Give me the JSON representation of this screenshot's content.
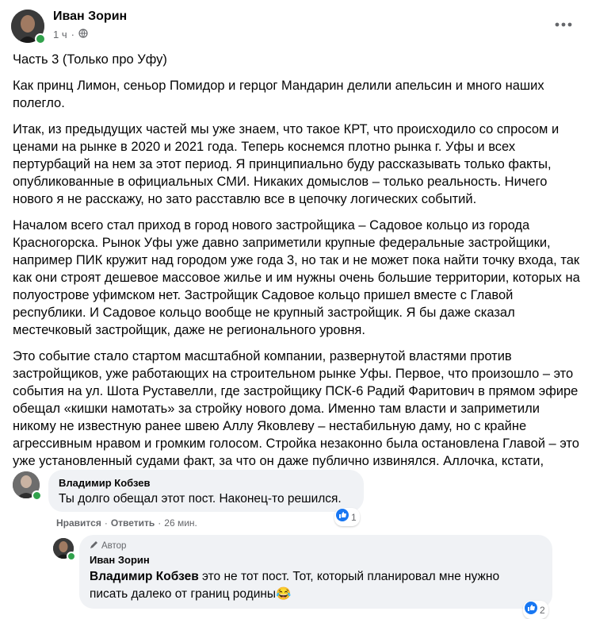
{
  "post": {
    "author": "Иван Зорин",
    "time": "1 ч",
    "separator": "·",
    "visibility_icon": "globe-icon",
    "paragraphs": [
      "Часть 3 (Только про Уфу)",
      "Как принц Лимон, сеньор Помидор и герцог Мандарин делили апельсин и много наших полегло.",
      "Итак, из предыдущих частей мы уже знаем, что такое КРТ, что происходило со спросом и ценами на рынке в 2020 и 2021 года. Теперь коснемся плотно рынка г. Уфы и всех пертурбаций на нем за этот период. Я принципиально буду рассказывать только факты, опубликованные в официальных СМИ. Никаких домыслов – только реальность. Ничего нового я не расскажу, но зато расставлю все в цепочку логических событий.",
      "Началом всего стал приход в город нового застройщика – Садовое кольцо из города Красногорска. Рынок Уфы уже давно заприметили крупные федеральные застройщики, например ПИК кружит над городом уже года 3, но так и не может пока найти точку входа, так как они строят дешевое массовое жилье и им нужны очень большие территории, которых на полуострове уфимском нет. Застройщик Садовое кольцо пришел вместе с Главой республики. И Садовое кольцо вообще не крупный застройщик. Я бы даже сказал местечковый застройщик, даже не регионального уровня.",
      "Это событие стало стартом масштабной компании, развернутой властями против застройщиков, уже работающих на строительном рынке Уфы. Первое, что произошло – это события на ул. Шота Руставелли, где застройщику ПСК-6 Радий Фаритович в прямом эфире обещал «кишки намотать» за стройку нового дома. Именно там власти и заприметили никому не известную ранее швею Аллу Яковлеву – нестабильную даму, но с крайне агрессивным нравом и громким голосом. Стройка незаконно была остановлена Главой – это уже установленный судами факт, за что он даже публично извинялся. Аллочка, кстати,"
    ]
  },
  "comment": {
    "author": "Владимир Кобзев",
    "text": "Ты долго обещал этот пост. Наконец-то решился.",
    "like_label": "Нравится",
    "reply_label": "Ответить",
    "time": "26 мин.",
    "reaction_count": "1"
  },
  "reply": {
    "badge": "Автор",
    "author": "Иван Зорин",
    "mention": "Владимир Кобзев",
    "text_line1": " это не тот пост. Тот, который планировал мне нужно",
    "text_line2": "писать далеко от границ родины",
    "emoji": "😂",
    "reaction_count": "2"
  },
  "colors": {
    "online": "#31a24c",
    "like_blue": "#1877f2",
    "bubble": "#f0f2f5"
  }
}
